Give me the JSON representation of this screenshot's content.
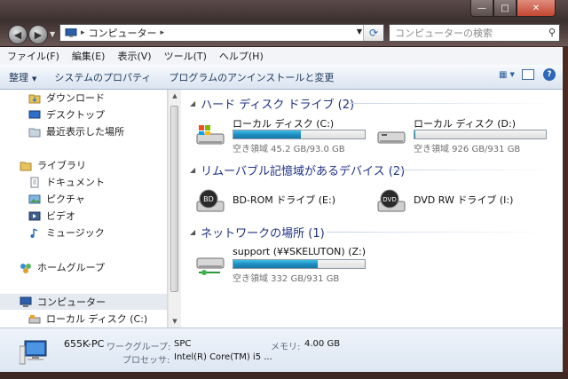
{
  "window": {
    "caption_buttons": {
      "minimize": "—",
      "maximize": "□",
      "close": "✕"
    }
  },
  "address_bar": {
    "crumb": "コンピューター",
    "search_placeholder": "コンピューターの検索"
  },
  "menu": [
    "ファイル(F)",
    "編集(E)",
    "表示(V)",
    "ツール(T)",
    "ヘルプ(H)"
  ],
  "commands": {
    "organize": "整理",
    "system_properties": "システムのプロパティ",
    "uninstall": "プログラムのアンインストールと変更"
  },
  "nav_pane": {
    "items": [
      {
        "label": "ダウンロード",
        "icon": "folder-download-icon"
      },
      {
        "label": "デスクトップ",
        "icon": "desktop-icon"
      },
      {
        "label": "最近表示した場所",
        "icon": "recent-places-icon"
      },
      {
        "label": "ライブラリ",
        "icon": "library-icon"
      },
      {
        "label": "ドキュメント",
        "icon": "documents-icon"
      },
      {
        "label": "ピクチャ",
        "icon": "pictures-icon"
      },
      {
        "label": "ビデオ",
        "icon": "videos-icon"
      },
      {
        "label": "ミュージック",
        "icon": "music-icon"
      },
      {
        "label": "ホームグループ",
        "icon": "homegroup-icon"
      },
      {
        "label": "コンピューター",
        "icon": "computer-icon"
      },
      {
        "label": "ローカル ディスク (C:)",
        "icon": "disk-icon"
      }
    ]
  },
  "groups": {
    "hdd": "ハード ディスク ドライブ (2)",
    "removable": "リムーバブル記憶域があるデバイス (2)",
    "network": "ネットワークの場所 (1)"
  },
  "drives": {
    "c": {
      "name": "ローカル ディスク (C:)",
      "free": "空き領域 45.2 GB/93.0 GB",
      "used_fraction": 0.514
    },
    "d": {
      "name": "ローカル ディスク (D:)",
      "free": "空き領域 926 GB/931 GB",
      "used_fraction": 0.005
    },
    "e": {
      "name": "BD-ROM ドライブ (E:)",
      "badge": "BD"
    },
    "i": {
      "name": "DVD RW ドライブ (I:)",
      "badge": "DVD"
    },
    "z": {
      "name": "support (¥¥SKELUTON) (Z:)",
      "free": "空き領域 332 GB/931 GB",
      "used_fraction": 0.643
    }
  },
  "details": {
    "computer_name": "655K-PC",
    "workgroup_label": "ワークグループ:",
    "workgroup": "SPC",
    "memory_label": "メモリ:",
    "memory": "4.00 GB",
    "processor_label": "プロセッサ:",
    "processor": "Intel(R) Core(TM) i5 ..."
  },
  "colors": {
    "progress": "#1f8fc0",
    "group_header": "#1e3287",
    "selection": "#e5eaf1"
  }
}
